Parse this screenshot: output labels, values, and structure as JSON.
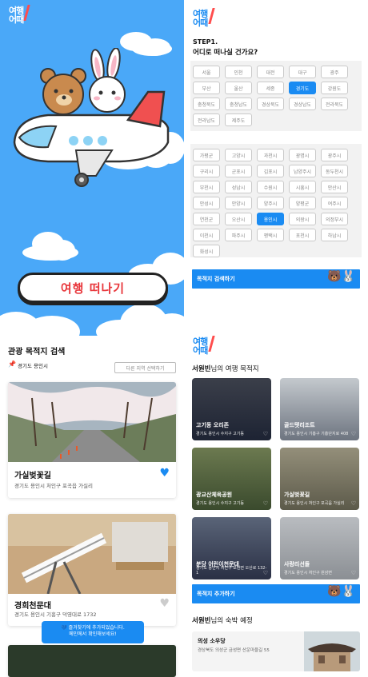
{
  "splash": {
    "logo_line1": "여행",
    "logo_line2": "어때",
    "start_label": "여행 떠나기"
  },
  "step": {
    "logo_line1": "여행",
    "logo_line2": "어때",
    "step_label": "STEP1.",
    "question": "어디로 떠나실 건가요?",
    "provinces": [
      "서울",
      "인천",
      "대전",
      "대구",
      "광주",
      "부산",
      "울산",
      "세종",
      "경기도",
      "강원도",
      "충청북도",
      "충청남도",
      "경상북도",
      "경상남도",
      "전라북도",
      "전라남도",
      "제주도"
    ],
    "selected_province": "경기도",
    "cities": [
      "가평군",
      "고양시",
      "과천시",
      "광명시",
      "광주시",
      "구리시",
      "군포시",
      "김포시",
      "남양주시",
      "동두천시",
      "부천시",
      "성남시",
      "수원시",
      "시흥시",
      "안산시",
      "안성시",
      "안양시",
      "양주시",
      "양평군",
      "여주시",
      "연천군",
      "오산시",
      "용인시",
      "의왕시",
      "의정부시",
      "이천시",
      "파주시",
      "평택시",
      "포천시",
      "하남시",
      "화성시"
    ],
    "selected_city": "용인시",
    "search_label": "목적지 검색하기"
  },
  "search": {
    "title": "관광 목적지 검색",
    "region": "경기도 용인시",
    "other_region_label": "다른 지역 선택하기",
    "cards": [
      {
        "name": "가실벚꽃길",
        "address": "경기도 용인시 처인구 포곡읍 가실리",
        "liked": true
      },
      {
        "name": "경희천문대",
        "address": "경기도 용인시 기흥구 덕영대로 1732",
        "liked": false
      }
    ],
    "toast_line1": "즐겨찾기에 추가되었습니다.",
    "toast_line2": "메인에서 확인해보세요!"
  },
  "profile": {
    "logo_line1": "여행",
    "logo_line2": "어때",
    "user": "서원빈",
    "dest_suffix": "님의 여행 목적지",
    "destinations": [
      {
        "name": "고기동 오리존",
        "address": "경기도 용인시 수지구 고기동"
      },
      {
        "name": "골드텟리조트",
        "address": "경기도 용인시 기흥구 기흥단지로 408"
      },
      {
        "name": "광교산체육공원",
        "address": "경기도 용인시 수지구 고기동"
      },
      {
        "name": "가실벚꽃길",
        "address": "경기도 용인시 처인구 포곡읍 가실리"
      },
      {
        "name": "분당 어린이천문대",
        "address": "경기도 용인시 처인구 모현면 오산로 132-1"
      },
      {
        "name": "사랑리선돌",
        "address": "경기도 용인시 처인구 원삼면"
      }
    ],
    "add_label": "목적지 추가하기",
    "stay_suffix": "님의 숙박 예정",
    "stay": {
      "name": "의성 소우당",
      "address": "경상북도 의성군 금성면 산운마을길 55"
    }
  },
  "colors": {
    "sky": "#4aa8f8",
    "primary": "#1a8bf2",
    "accent": "#e8373c",
    "heart": "#1a8bf2"
  }
}
